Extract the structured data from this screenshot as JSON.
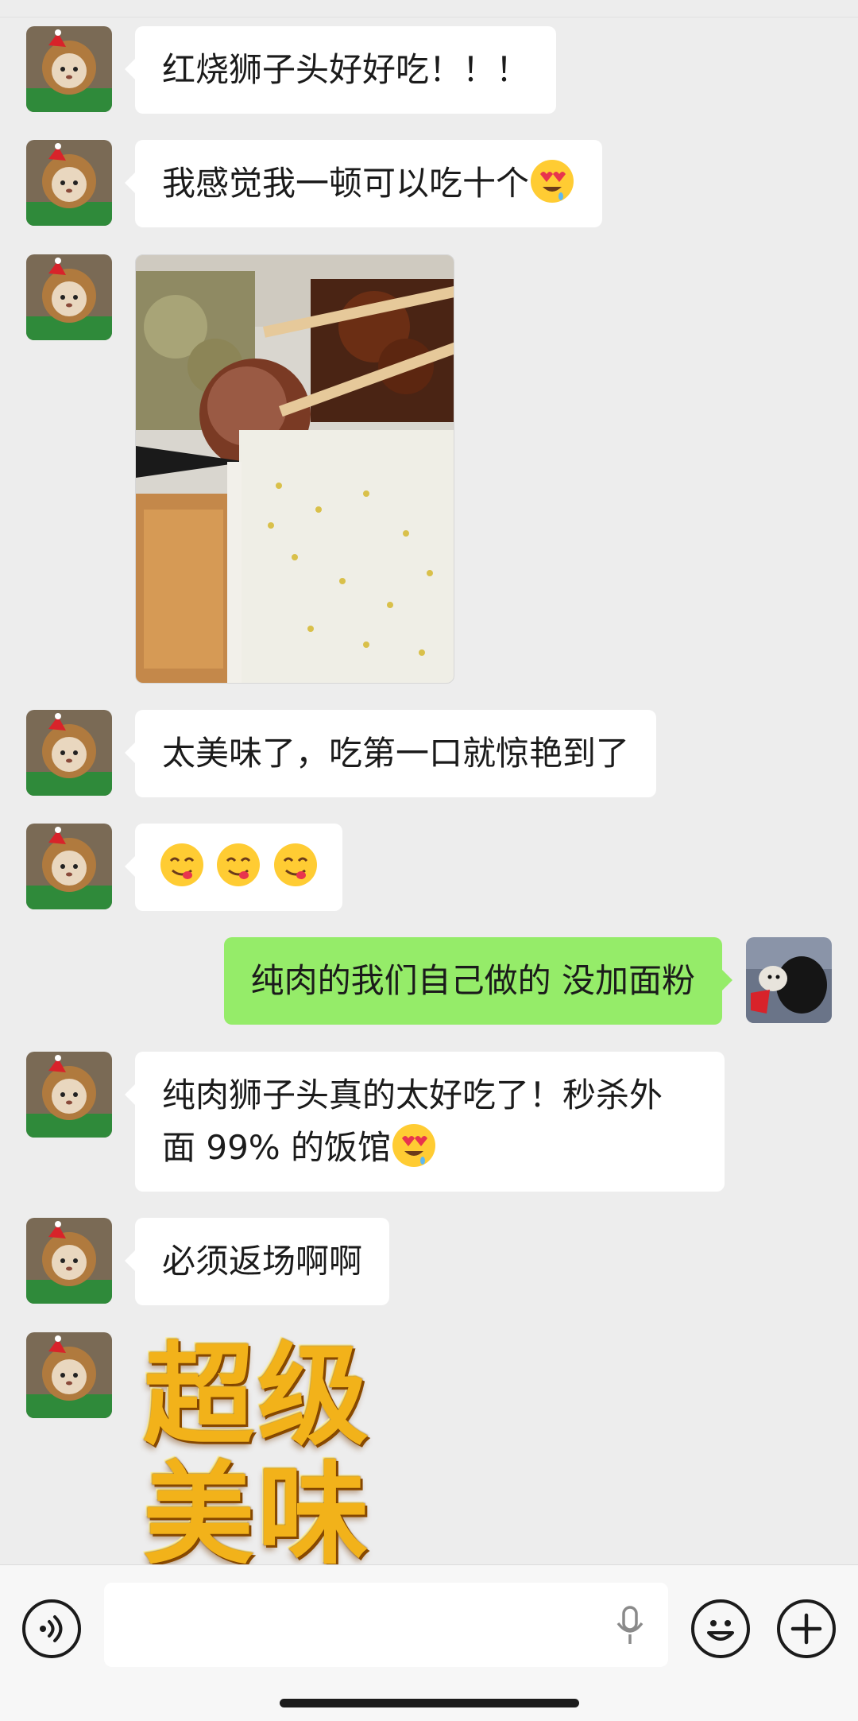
{
  "messages": [
    {
      "from": "contact",
      "text": "红烧狮子头好好吃！！！"
    },
    {
      "from": "contact",
      "text": "我感觉我一顿可以吃十个",
      "emoji": "heart-eyes-drool"
    },
    {
      "from": "contact",
      "type": "image",
      "image": "braised-pork-meatball-rice-photo"
    },
    {
      "from": "contact",
      "text": "太美味了，吃第一口就惊艳到了"
    },
    {
      "from": "contact",
      "type": "emoji",
      "emojis": [
        "yum-face",
        "yum-face",
        "yum-face"
      ]
    },
    {
      "from": "me",
      "text": "纯肉的我们自己做的 没加面粉"
    },
    {
      "from": "contact",
      "text_line1": "纯肉狮子头真的太好吃了！秒杀外",
      "text_line2": "面 99% 的饭馆",
      "emoji": "heart-eyes-drool"
    },
    {
      "from": "contact",
      "text": "必须返场啊啊"
    },
    {
      "from": "contact",
      "type": "sticker",
      "line1": "超级",
      "line2": "美味"
    }
  ],
  "input": {
    "value": "",
    "voice_icon": "voice-icon",
    "mic_icon": "mic-icon",
    "emoji_icon": "emoji-icon",
    "plus_icon": "plus-icon"
  },
  "colors": {
    "background": "#ededed",
    "bubble_in": "#ffffff",
    "bubble_out": "#95ec69",
    "sticker_gold": "#f2b21a"
  }
}
